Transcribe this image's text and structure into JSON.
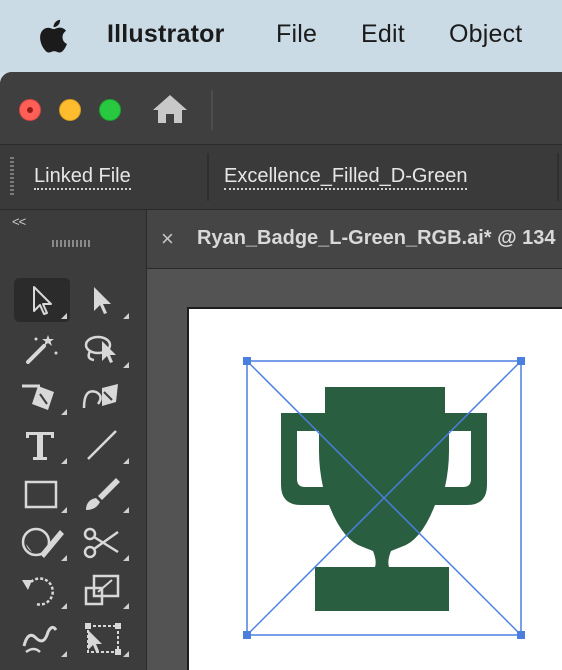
{
  "menubar": {
    "app_name": "Illustrator",
    "items": [
      "File",
      "Edit",
      "Object"
    ]
  },
  "controlbar": {
    "linked_file_label": "Linked File",
    "file_name": "Excellence_Filled_D-Green"
  },
  "toolbar": {
    "collapse_label": "<<",
    "tools": [
      {
        "name": "selection-tool",
        "selected": true
      },
      {
        "name": "direct-selection-tool"
      },
      {
        "name": "magic-wand-tool"
      },
      {
        "name": "lasso-tool"
      },
      {
        "name": "pen-tool"
      },
      {
        "name": "curvature-tool"
      },
      {
        "name": "type-tool"
      },
      {
        "name": "line-segment-tool"
      },
      {
        "name": "rectangle-tool"
      },
      {
        "name": "paintbrush-tool"
      },
      {
        "name": "shaper-tool"
      },
      {
        "name": "scissors-tool"
      },
      {
        "name": "rotate-tool"
      },
      {
        "name": "scale-tool"
      },
      {
        "name": "warp-tool"
      },
      {
        "name": "free-transform-tool"
      }
    ]
  },
  "document": {
    "tab_close": "×",
    "tab_title": "Ryan_Badge_L-Green_RGB.ai* @ 134"
  },
  "artwork": {
    "icon": "trophy-icon",
    "fill_color": "#2a5e41",
    "selection_color": "#4a7fe0"
  },
  "colors": {
    "menubar_bg": "#cadbe6",
    "window_bg": "#535353",
    "panel_bg": "#3c3c3c"
  }
}
